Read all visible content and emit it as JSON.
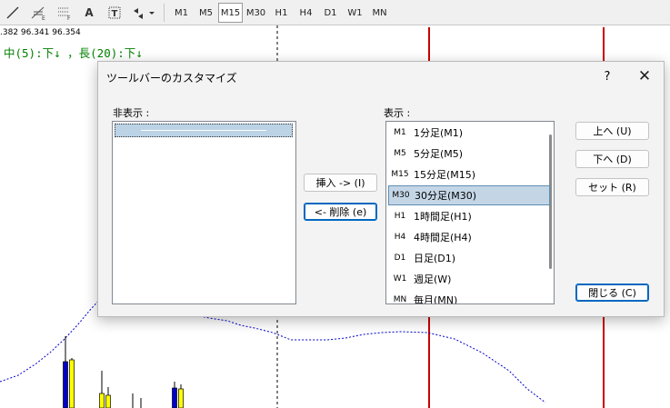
{
  "toolbar": {
    "tools": [
      {
        "icon": "trendline-icon",
        "glyph": "╱"
      },
      {
        "icon": "fibonacci-expansion-icon",
        "glyph": "⋰",
        "sub": "E"
      },
      {
        "icon": "fibonacci-retracement-icon",
        "glyph": "≡",
        "sub": "F"
      },
      {
        "icon": "text-icon",
        "glyph": "A"
      },
      {
        "icon": "text-label-icon",
        "glyph": "T"
      },
      {
        "icon": "arrows-dropdown-icon",
        "glyph": "⬥▾"
      }
    ],
    "timeframes": [
      "M1",
      "M5",
      "M15",
      "M30",
      "H1",
      "H4",
      "D1",
      "W1",
      "MN"
    ],
    "active_timeframe": "M15"
  },
  "chart": {
    "price_text": ".382 96.341 96.354",
    "indicator_text": "中(5):下↓ ，長(20):下↓",
    "vline_color": "#cc0000",
    "ma_color": "#0000cc",
    "bull_color": "#ffff00",
    "bear_color": "#0000cc"
  },
  "dialog": {
    "title": "ツールバーのカスタマイズ",
    "help_label": "?",
    "close_label": "✕",
    "hidden_label": "非表示 :",
    "shown_label": "表示 :",
    "items": [
      {
        "code": "M1",
        "name": "1分足(M1)"
      },
      {
        "code": "M5",
        "name": "5分足(M5)"
      },
      {
        "code": "M15",
        "name": "15分足(M15)"
      },
      {
        "code": "M30",
        "name": "30分足(M30)"
      },
      {
        "code": "H1",
        "name": "1時間足(H1)"
      },
      {
        "code": "H4",
        "name": "4時間足(H4)"
      },
      {
        "code": "D1",
        "name": "日足(D1)"
      },
      {
        "code": "W1",
        "name": "週足(W)"
      },
      {
        "code": "MN",
        "name": "毎月(MN)"
      }
    ],
    "selected_index": 3,
    "insert_label": "挿入 -> (I)",
    "delete_label": "<- 削除 (e)",
    "up_label": "上へ (U)",
    "down_label": "下へ (D)",
    "reset_label": "セット (R)",
    "close_btn_label": "閉じる (C)",
    "accent": "#0067c0"
  }
}
